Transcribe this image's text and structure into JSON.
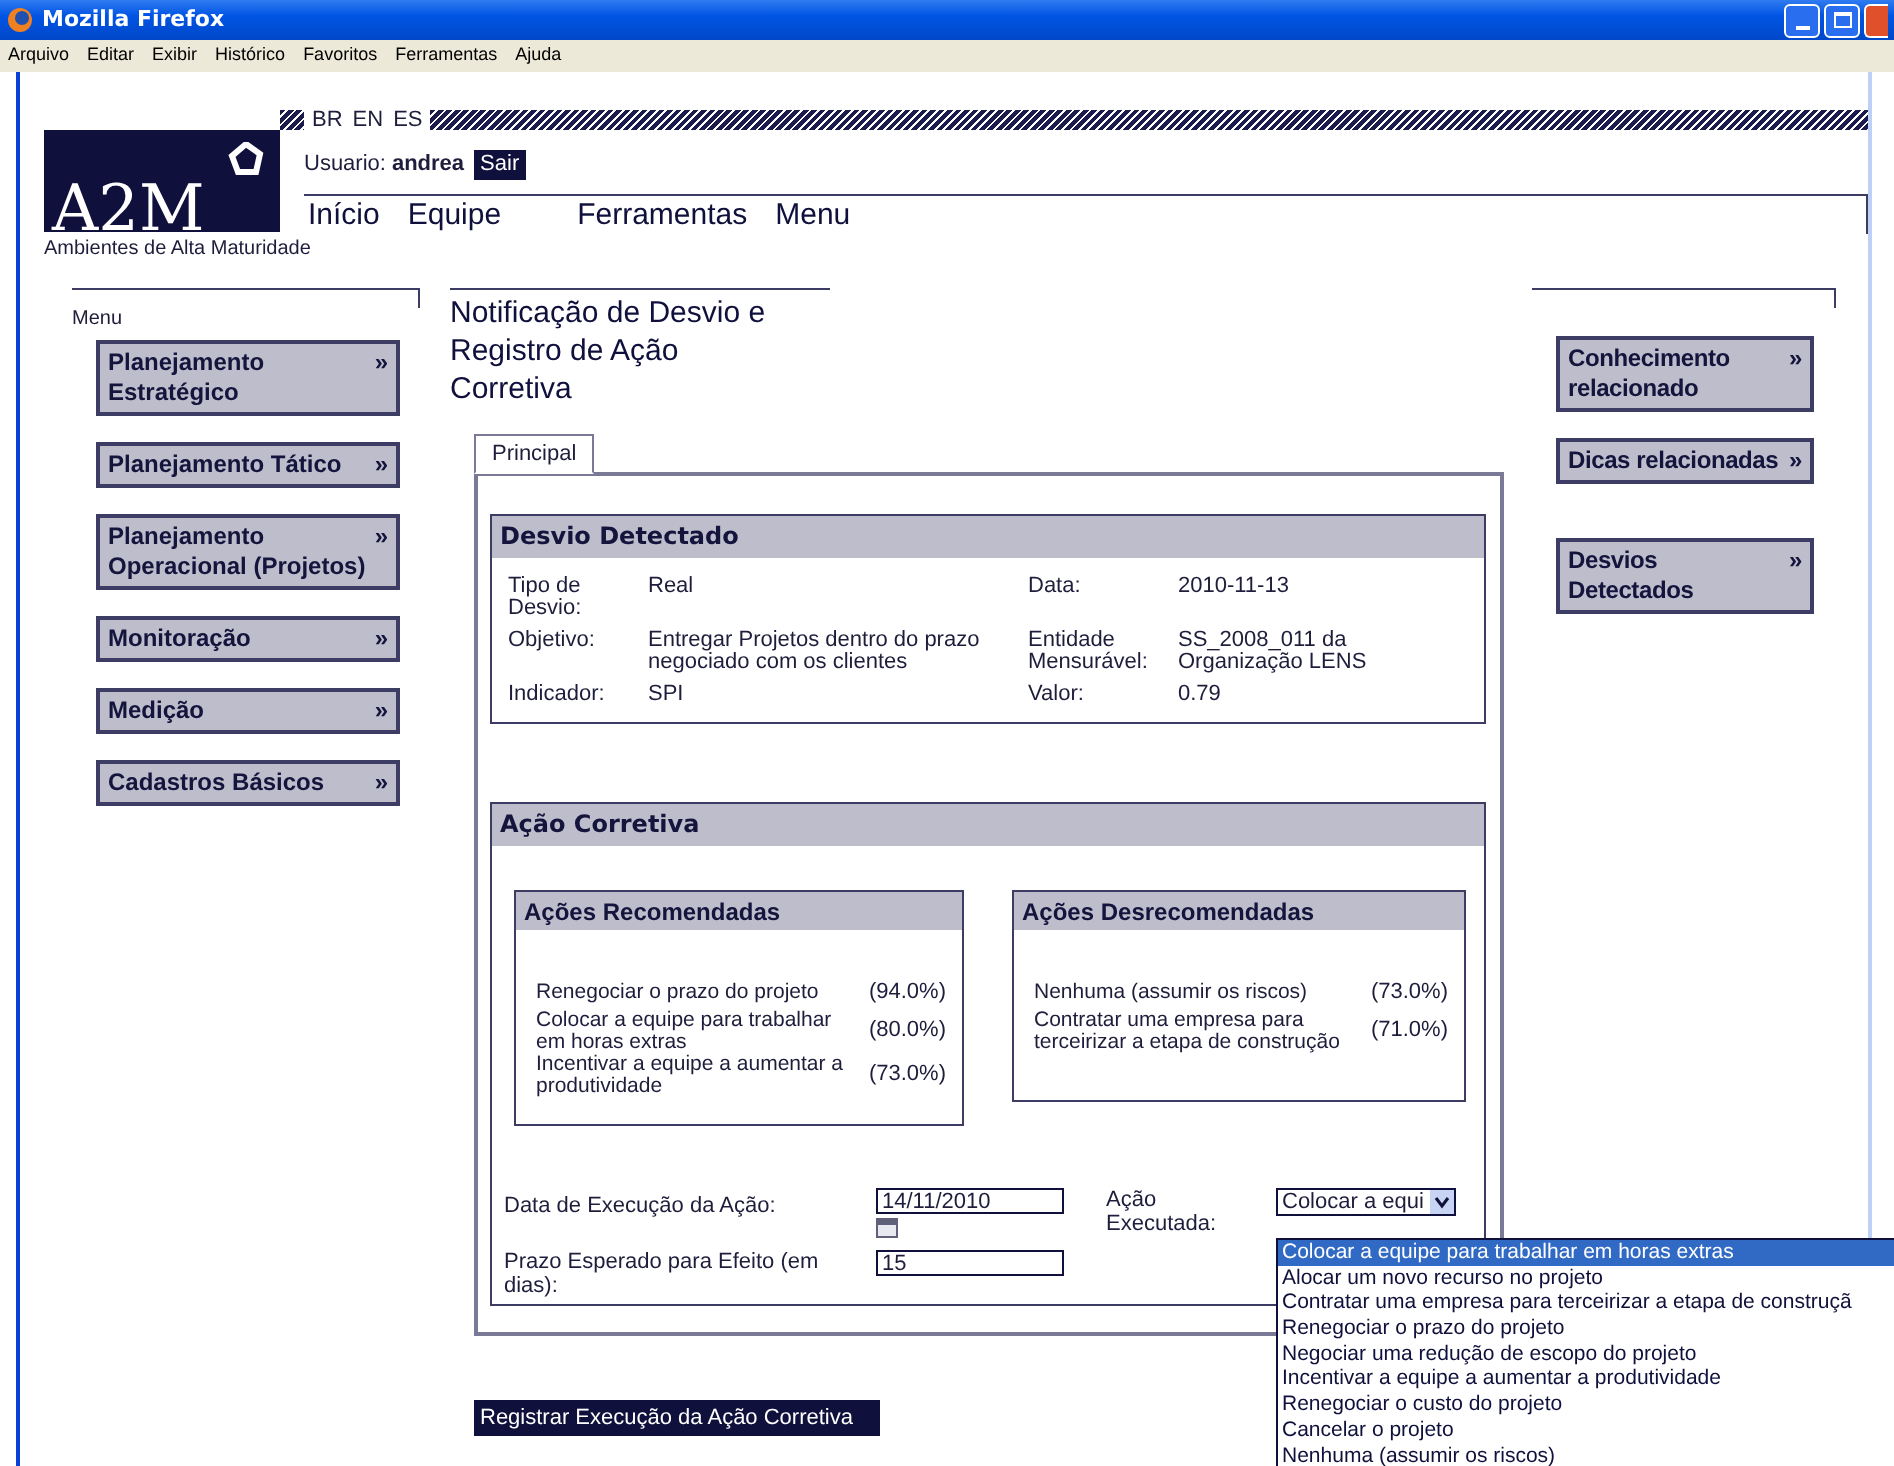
{
  "window": {
    "title": "Mozilla Firefox"
  },
  "menu_bar": [
    "Arquivo",
    "Editar",
    "Exibir",
    "Histórico",
    "Favoritos",
    "Ferramentas",
    "Ajuda"
  ],
  "header": {
    "languages": [
      "BR",
      "EN",
      "ES"
    ],
    "logo": "A2M",
    "tagline": "Ambientes de Alta Maturidade",
    "user_label": "Usuario:",
    "user_name": "andrea",
    "logout": "Sair",
    "nav": [
      "Início",
      "Equipe",
      "Ferramentas",
      "Menu"
    ]
  },
  "left_menu": {
    "title": "Menu",
    "items": [
      {
        "label": "Planejamento Estratégico",
        "arrow": "»"
      },
      {
        "label": "Planejamento Tático",
        "arrow": "»"
      },
      {
        "label": "Planejamento Operacional (Projetos)",
        "arrow": "»"
      },
      {
        "label": "Monitoração",
        "arrow": "»"
      },
      {
        "label": "Medição",
        "arrow": "»"
      },
      {
        "label": "Cadastros Básicos",
        "arrow": "»"
      }
    ]
  },
  "page_title": "Notificação de Desvio e Registro de Ação Corretiva",
  "tabs": [
    {
      "label": "Principal",
      "selected": true
    }
  ],
  "deviation": {
    "title": "Desvio Detectado",
    "rows": [
      [
        {
          "label": "Tipo de Desvio:",
          "value": "Real"
        },
        {
          "label": "Data:",
          "value": "2010-11-13"
        }
      ],
      [
        {
          "label": "Objetivo:",
          "value": "Entregar Projetos dentro do prazo negociado com os clientes"
        },
        {
          "label": "Entidade Mensurável:",
          "value": "SS_2008_011 da Organização LENS"
        }
      ],
      [
        {
          "label": "Indicador:",
          "value": "SPI"
        },
        {
          "label": "Valor:",
          "value": "0.79"
        }
      ]
    ]
  },
  "corrective_action": {
    "title": "Ação Corretiva",
    "recommended": {
      "title": "Ações Recomendadas",
      "items": [
        {
          "action": "Renegociar o prazo do projeto",
          "score": "(94.0%)"
        },
        {
          "action": "Colocar a equipe para trabalhar em horas extras",
          "score": "(80.0%)"
        },
        {
          "action": "Incentivar a equipe a aumentar a produtividade",
          "score": "(73.0%)"
        }
      ]
    },
    "not_recommended": {
      "title": "Ações Desrecomendadas",
      "items": [
        {
          "action": "Nenhuma (assumir os riscos)",
          "score": "(73.0%)"
        },
        {
          "action": "Contratar uma empresa para terceirizar a etapa de construção",
          "score": "(71.0%)"
        }
      ]
    },
    "execution_date": {
      "label": "Data de Execução da Ação:",
      "value": "14/11/2010"
    },
    "expected_term": {
      "label": "Prazo Esperado para Efeito (em dias):",
      "value": "15"
    },
    "executed_action": {
      "label": "Ação Executada:",
      "value": "Colocar a equi",
      "options": [
        {
          "label": "Colocar a equipe para trabalhar em horas extras",
          "selected": true
        },
        {
          "label": "Alocar um novo recurso no projeto",
          "selected": false
        },
        {
          "label": "Contratar uma empresa para terceirizar a etapa de construçã",
          "selected": false
        },
        {
          "label": "Renegociar o prazo do projeto",
          "selected": false
        },
        {
          "label": "Negociar uma redução de escopo do projeto",
          "selected": false
        },
        {
          "label": "Incentivar a equipe a aumentar a produtividade",
          "selected": false
        },
        {
          "label": "Renegociar o custo do projeto",
          "selected": false
        },
        {
          "label": "Cancelar o projeto",
          "selected": false
        },
        {
          "label": "Nenhuma (assumir os riscos)",
          "selected": false
        }
      ]
    }
  },
  "submit": "Registrar Execução da Ação Corretiva",
  "right_menu": {
    "items": [
      {
        "label": "Conhecimento relacionado",
        "arrow": "»"
      },
      {
        "label": "Dicas relacionadas",
        "arrow": "»"
      },
      {
        "label": "Desvios Detectados",
        "arrow": "»"
      }
    ]
  }
}
